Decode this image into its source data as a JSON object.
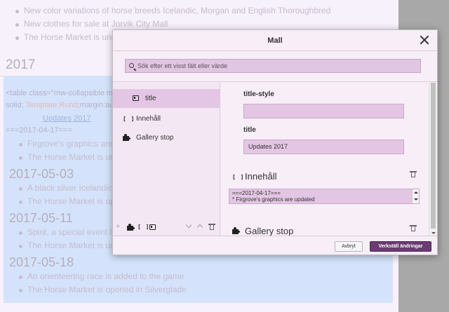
{
  "background": {
    "top_items": [
      "New color variations of horse breeds Icelandic, Morgan and English Thoroughbred",
      "New clothes for sale at Jorvik City Mall",
      "The Horse Market is under"
    ],
    "year_heading": "2017",
    "code_line_1": "<table class=\"mw-collapsible mw",
    "code_line_2a": "solid; ",
    "code_line_2b": "Template:Rund",
    "code_line_2c": ";margin:aut",
    "updates_caption": "Updates 2017",
    "raw_heading": "===2017-04-17===",
    "raw_items": [
      "Firgrove's graphics are upd",
      "The Horse Market is under"
    ],
    "sections": [
      {
        "date": "2017-05-03",
        "items": [
          "A black silver Icelandic hor",
          "The Horse Market is opene"
        ]
      },
      {
        "date": "2017-05-11",
        "items": [
          "Spirit, a special event horse",
          "The Horse Market is under"
        ]
      },
      {
        "date": "2017-05-18",
        "items": [
          "An orienteering race is added to the game",
          "The Horse Market is opened in Silverglade"
        ]
      }
    ]
  },
  "dialog": {
    "title": "Mall",
    "search": {
      "placeholder": "Sök efter ett visst fält eller värde",
      "value": ""
    },
    "outline": {
      "title_item": "title",
      "content_item": "Innehåll",
      "gallery_item": "Gallery stop"
    },
    "fields": {
      "title_style_label": "title-style",
      "title_style_value": "",
      "title_label": "title",
      "title_value": "Updates 2017"
    },
    "content_section": {
      "title": "Innehåll",
      "text_line_1": "===2017-04-17===",
      "text_line_2": "* Firgrove's graphics are updated"
    },
    "gallery_section": {
      "title": "Gallery stop"
    },
    "buttons": {
      "cancel": "Avbryt",
      "apply": "Verkställ ändringar"
    }
  },
  "icons": {
    "template": "template-icon",
    "brackets": "brackets-icon",
    "puzzle": "puzzle-icon",
    "trash": "trash-icon",
    "close": "close-icon",
    "search": "search-icon"
  },
  "colors": {
    "primary_button": "#6b3b73",
    "selected_bg": "#e3c6e3",
    "selection_highlight": "#d4e3fb"
  }
}
